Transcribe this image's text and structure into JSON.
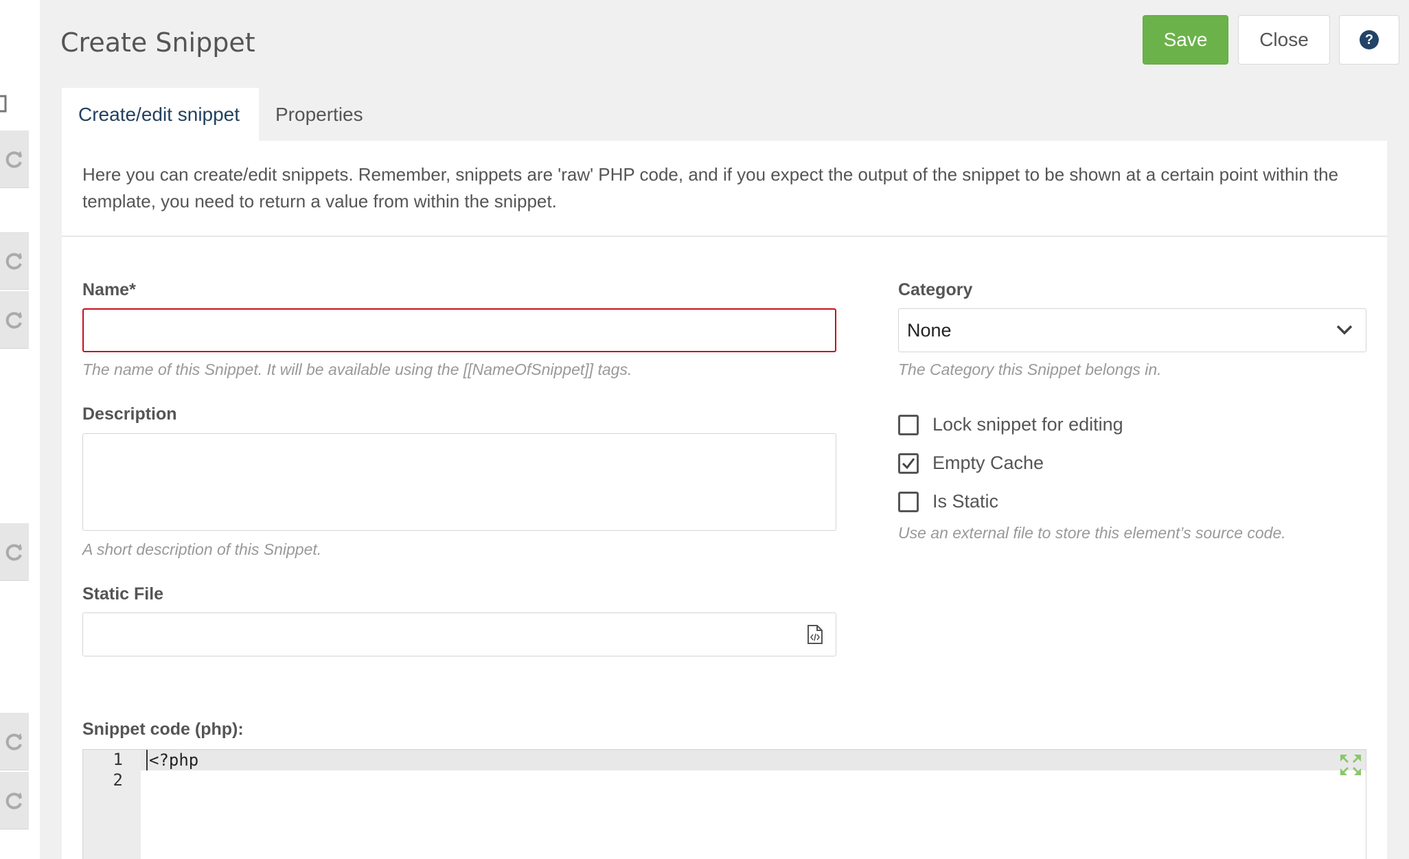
{
  "header": {
    "title": "Create Snippet",
    "save_label": "Save",
    "close_label": "Close",
    "help_glyph": "?"
  },
  "tabs": [
    {
      "label": "Create/edit snippet",
      "active": true
    },
    {
      "label": "Properties",
      "active": false
    }
  ],
  "intro": "Here you can create/edit snippets. Remember, snippets are 'raw' PHP code, and if you expect the output of the snippet to be shown at a certain point within the template, you need to return a value from within the snippet.",
  "form": {
    "name": {
      "label": "Name*",
      "value": "",
      "hint": "The name of this Snippet. It will be available using the [[NameOfSnippet]] tags."
    },
    "description": {
      "label": "Description",
      "value": "",
      "hint": "A short description of this Snippet."
    },
    "static_file": {
      "label": "Static File",
      "value": ""
    },
    "category": {
      "label": "Category",
      "value": "None",
      "hint": "The Category this Snippet belongs in."
    },
    "checkboxes": [
      {
        "label": "Lock snippet for editing",
        "checked": false
      },
      {
        "label": "Empty Cache",
        "checked": true
      },
      {
        "label": "Is Static",
        "checked": false
      }
    ],
    "static_hint": "Use an external file to store this element’s source code."
  },
  "editor": {
    "label": "Snippet code (php):",
    "line_numbers": [
      "1",
      "2"
    ],
    "code_line1": "<?php"
  },
  "colors": {
    "save_green": "#6cb24a",
    "error_red": "#c4101c",
    "help_navy": "#234368",
    "tab_active_text": "#23415e"
  },
  "icons": {
    "sidebar": "refresh-icon",
    "help": "question-circle-icon",
    "category": "chevron-down-icon",
    "static_file": "file-code-icon",
    "editor": "expand-icon",
    "checkbox": "check-icon"
  }
}
